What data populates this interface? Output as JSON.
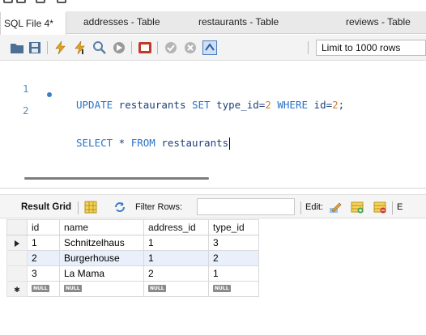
{
  "tabs": [
    {
      "label": "SQL File 4*",
      "active": true
    },
    {
      "label": "addresses - Table",
      "active": false
    },
    {
      "label": "restaurants - Table",
      "active": false
    },
    {
      "label": "reviews - Table",
      "active": false
    }
  ],
  "toolbar": {
    "limit_label": "Limit to 1000 rows",
    "icons": [
      "folder-icon",
      "save-icon",
      "lightning-icon",
      "lightning-cursor-icon",
      "magnifier-icon",
      "stop-icon",
      "toggle-icon",
      "check-icon",
      "cancel-icon",
      "autocommit-icon"
    ]
  },
  "editor": {
    "lines": [
      {
        "number": "1",
        "parts": [
          {
            "t": "UPDATE",
            "c": "kw"
          },
          {
            "t": " restaurants ",
            "c": "txt"
          },
          {
            "t": "SET",
            "c": "kw"
          },
          {
            "t": " type_id=",
            "c": "txt"
          },
          {
            "t": "2",
            "c": "num"
          },
          {
            "t": " ",
            "c": "txt"
          },
          {
            "t": "WHERE",
            "c": "kw"
          },
          {
            "t": " id=",
            "c": "txt"
          },
          {
            "t": "2",
            "c": "num"
          },
          {
            "t": ";",
            "c": "txt"
          }
        ]
      },
      {
        "number": "2",
        "parts": [
          {
            "t": "SELECT",
            "c": "kw"
          },
          {
            "t": " * ",
            "c": "txt"
          },
          {
            "t": "FROM",
            "c": "kw"
          },
          {
            "t": " restaurants",
            "c": "txt"
          }
        ]
      }
    ]
  },
  "result_toolbar": {
    "result_grid_label": "Result Grid",
    "filter_label": "Filter Rows:",
    "filter_value": "",
    "edit_label": "Edit:",
    "trailing_label": "E"
  },
  "grid": {
    "columns": [
      "id",
      "name",
      "address_id",
      "type_id"
    ],
    "rows": [
      [
        "1",
        "Schnitzelhaus",
        "1",
        "3"
      ],
      [
        "2",
        "Burgerhouse",
        "1",
        "2"
      ],
      [
        "3",
        "La Mama",
        "2",
        "1"
      ]
    ],
    "new_row": [
      "NULL",
      "NULL",
      "NULL",
      "NULL"
    ]
  },
  "colors": {
    "keyword": "#2a73c7",
    "number": "#d97b2a",
    "identifier": "#1f3f7a",
    "line_number": "#5a8eb8",
    "alt_row": "#e9f0fb"
  }
}
